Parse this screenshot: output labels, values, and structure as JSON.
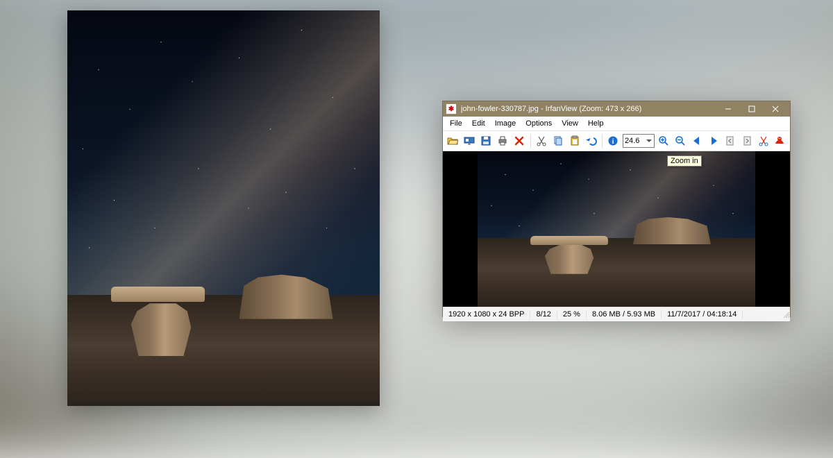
{
  "window": {
    "title": "john-fowler-330787.jpg - IrfanView (Zoom: 473 x 266)"
  },
  "menu": {
    "file": "File",
    "edit": "Edit",
    "image": "Image",
    "options": "Options",
    "view": "View",
    "help": "Help"
  },
  "toolbar": {
    "zoom_value": "24.6",
    "tooltip": "Zoom in"
  },
  "status": {
    "dims": "1920 x 1080 x 24 BPP",
    "index": "8/12",
    "zoom": "25 %",
    "sizes": "8.06 MB / 5.93 MB",
    "datetime": "11/7/2017 / 04:18:14"
  }
}
